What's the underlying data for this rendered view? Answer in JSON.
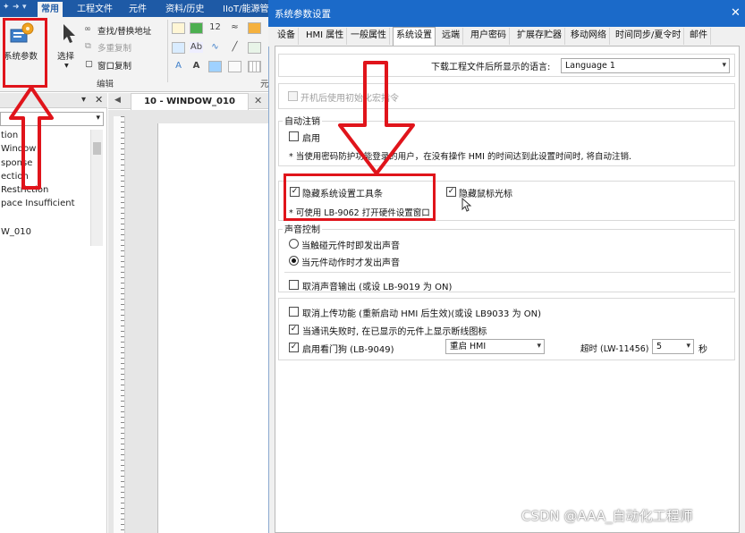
{
  "app": {
    "ribbon_tabs": [
      "常用",
      "工程文件",
      "元件",
      "资料/历史",
      "IIoT/能源管"
    ],
    "active_tab": "常用",
    "sys_param_label": "系统参数",
    "select_label": "选择",
    "find_replace_label": "查找/替换地址",
    "multi_copy_label": "多重复制",
    "window_copy_label": "窗口复制",
    "edit_group_label": "编辑",
    "clipped_group_label": "元",
    "doc_tab_label": "10 - WINDOW_010",
    "tree_items": [
      "tion",
      "Window",
      "sponse",
      "ection",
      "Restriction",
      "pace Insufficient",
      "W_010"
    ]
  },
  "dialog": {
    "title": "系统参数设置",
    "close_glyph": "✕",
    "tabs": [
      "设备",
      "HMI 属性",
      "一般属性",
      "系统设置",
      "远端",
      "用户密码",
      "扩展存贮器",
      "移动网络",
      "时间同步/夏令时",
      "邮件"
    ],
    "active_tab": "系统设置",
    "language_label": "下载工程文件后所显示的语言:",
    "language_value": "Language 1",
    "boot_init_label": "开机后使用初始化宏指令",
    "auto_logout_group": "自动注销",
    "enable_label": "启用",
    "auto_logout_note": "* 当使用密码防护功能登录的用户，在没有操作 HMI 的时间达到此设置时间时, 将自动注销.",
    "hide_toolbar_label": "隐藏系统设置工具条",
    "hide_toolbar_checked": true,
    "hide_cursor_label": "隐藏鼠标光标",
    "hide_cursor_checked": true,
    "hide_toolbar_note": "* 可使用 LB-9062 打开硬件设置窗口",
    "sound_group": "声音控制",
    "sound_on_touch": "当触碰元件时即发出声音",
    "sound_on_action": "当元件动作时才发出声音",
    "sound_selected": "当元件动作时才发出声音",
    "cancel_sound_label": "取消声音输出 (或设 LB-9019 为 ON)",
    "cancel_upload_label": "取消上传功能 (重新启动 HMI 后生效)(或设 LB9033 为 ON)",
    "show_disconnect_label": "当通讯失败时, 在已显示的元件上显示断线图标",
    "show_disconnect_checked": true,
    "watchdog_label": "启用看门狗 (LB-9049)",
    "watchdog_checked": true,
    "watchdog_action": "重启 HMI",
    "timeout_label": "超时 (LW-11456) :",
    "timeout_value": "5",
    "timeout_unit": "秒"
  },
  "watermark": "CSDN @AAA_自动化工程师",
  "colors": {
    "title_bar": "#1b6ac9",
    "app_bar": "#1e5aa6",
    "annotation_red": "#e0141b"
  }
}
